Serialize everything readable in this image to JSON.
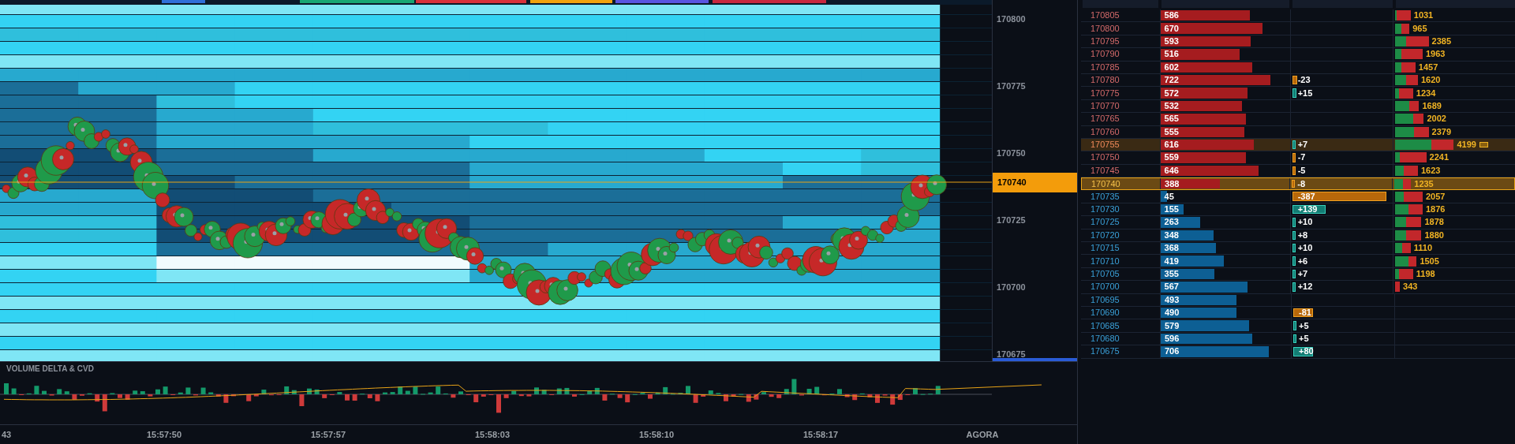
{
  "top_strip": [
    {
      "color": "#2f6fd8"
    },
    {
      "color": "#18a673"
    },
    {
      "color": "#d8313b"
    },
    {
      "color": "#f2a20c"
    },
    {
      "color": "#5a55e0"
    },
    {
      "color": "#c8283f"
    }
  ],
  "price_axis": {
    "labels": [
      "170800",
      "170775",
      "170750",
      "170725",
      "170700",
      "170675"
    ],
    "current": "170740"
  },
  "indicator": {
    "title": "VOLUME DELTA & CVD"
  },
  "time_axis": [
    "43",
    "15:57:50",
    "15:57:57",
    "15:58:03",
    "15:58:10",
    "15:58:17",
    "AGORA"
  ],
  "ladder": [
    {
      "price": "170805",
      "kind": "ask",
      "selected": false,
      "highlighted": false,
      "volume": {
        "text": "586",
        "level": 0.69
      },
      "traded": {
        "text": "1031",
        "level": 0.13,
        "buy": {
          "level": 0.01
        }
      }
    },
    {
      "price": "170800",
      "kind": "ask",
      "selected": false,
      "highlighted": false,
      "volume": {
        "text": "670",
        "level": 0.79
      },
      "traded": {
        "text": "965",
        "level": 0.12,
        "buy": {
          "level": 0.05
        }
      }
    },
    {
      "price": "170795",
      "kind": "ask",
      "selected": false,
      "highlighted": false,
      "volume": {
        "text": "593",
        "level": 0.7
      },
      "traded": {
        "text": "2385",
        "level": 0.28,
        "buy": {
          "level": 0.09
        }
      }
    },
    {
      "price": "170790",
      "kind": "ask",
      "selected": false,
      "highlighted": false,
      "volume": {
        "text": "516",
        "level": 0.61
      },
      "traded": {
        "text": "1963",
        "level": 0.23,
        "buy": {
          "level": 0.05
        }
      }
    },
    {
      "price": "170785",
      "kind": "ask",
      "selected": false,
      "highlighted": false,
      "volume": {
        "text": "602",
        "level": 0.71
      },
      "traded": {
        "text": "1457",
        "level": 0.17,
        "buy": {
          "level": 0.05
        }
      }
    },
    {
      "price": "170780",
      "kind": "ask",
      "selected": false,
      "highlighted": false,
      "volume": {
        "text": "722",
        "level": 0.85
      },
      "delta": {
        "text": "-23",
        "kind": "negative",
        "level": 0.05
      },
      "traded": {
        "text": "1620",
        "level": 0.19,
        "buy": {
          "level": 0.09
        }
      }
    },
    {
      "price": "170775",
      "kind": "ask",
      "selected": false,
      "highlighted": false,
      "volume": {
        "text": "572",
        "level": 0.67
      },
      "delta": {
        "text": "+15",
        "kind": "positive",
        "level": 0.04
      },
      "traded": {
        "text": "1234",
        "level": 0.15,
        "buy": {
          "level": 0.03
        }
      }
    },
    {
      "price": "170770",
      "kind": "ask",
      "selected": false,
      "highlighted": false,
      "volume": {
        "text": "532",
        "level": 0.63
      },
      "traded": {
        "text": "1689",
        "level": 0.2,
        "buy": {
          "level": 0.12
        }
      }
    },
    {
      "price": "170765",
      "kind": "ask",
      "selected": false,
      "highlighted": false,
      "volume": {
        "text": "565",
        "level": 0.66
      },
      "traded": {
        "text": "2002",
        "level": 0.24,
        "buy": {
          "level": 0.15
        }
      }
    },
    {
      "price": "170760",
      "kind": "ask",
      "selected": false,
      "highlighted": false,
      "volume": {
        "text": "555",
        "level": 0.65
      },
      "traded": {
        "text": "2379",
        "level": 0.28,
        "buy": {
          "level": 0.16
        }
      }
    },
    {
      "price": "170755",
      "kind": "ask",
      "selected": false,
      "highlighted": true,
      "volume": {
        "text": "616",
        "level": 0.72
      },
      "delta": {
        "text": "+7",
        "kind": "positive",
        "level": 0.03
      },
      "traded": {
        "text": "4199",
        "level": 0.49,
        "buy": {
          "level": 0.3
        }
      }
    },
    {
      "price": "170750",
      "kind": "ask",
      "selected": false,
      "highlighted": false,
      "volume": {
        "text": "559",
        "level": 0.66
      },
      "delta": {
        "text": "-7",
        "kind": "negative",
        "level": 0.03
      },
      "traded": {
        "text": "2241",
        "level": 0.26,
        "buy": {
          "level": 0.04
        }
      }
    },
    {
      "price": "170745",
      "kind": "ask",
      "selected": false,
      "highlighted": false,
      "volume": {
        "text": "646",
        "level": 0.76
      },
      "delta": {
        "text": "-5",
        "kind": "negative",
        "level": 0.03
      },
      "traded": {
        "text": "1623",
        "level": 0.19,
        "buy": {
          "level": 0.07
        }
      }
    },
    {
      "price": "170740",
      "kind": "ask",
      "selected": true,
      "highlighted": false,
      "volume": {
        "text": "388",
        "level": 0.46
      },
      "delta": {
        "text": "-8",
        "kind": "negative",
        "level": 0.03
      },
      "traded": {
        "text": "1235",
        "level": 0.14,
        "buy": {
          "level": 0.07
        }
      }
    },
    {
      "price": "170735",
      "kind": "bid",
      "selected": false,
      "highlighted": false,
      "volume": {
        "text": "45",
        "level": 0.05
      },
      "delta": {
        "text": "-387",
        "kind": "negative",
        "level": 0.92
      },
      "traded": {
        "text": "2057",
        "level": 0.23,
        "buy": {
          "level": 0.07
        }
      }
    },
    {
      "price": "170730",
      "kind": "bid",
      "selected": false,
      "highlighted": false,
      "volume": {
        "text": "155",
        "level": 0.18
      },
      "delta": {
        "text": "+139",
        "kind": "positive",
        "level": 0.33
      },
      "traded": {
        "text": "1876",
        "level": 0.23,
        "buy": {
          "level": 0.11
        }
      }
    },
    {
      "price": "170725",
      "kind": "bid",
      "selected": false,
      "highlighted": false,
      "volume": {
        "text": "263",
        "level": 0.31
      },
      "delta": {
        "text": "+10",
        "kind": "positive",
        "level": 0.03
      },
      "traded": {
        "text": "1878",
        "level": 0.22,
        "buy": {
          "level": 0.09
        }
      }
    },
    {
      "price": "170720",
      "kind": "bid",
      "selected": false,
      "highlighted": false,
      "volume": {
        "text": "348",
        "level": 0.41
      },
      "delta": {
        "text": "+8",
        "kind": "positive",
        "level": 0.03
      },
      "traded": {
        "text": "1880",
        "level": 0.22,
        "buy": {
          "level": 0.09
        }
      }
    },
    {
      "price": "170715",
      "kind": "bid",
      "selected": false,
      "highlighted": false,
      "volume": {
        "text": "368",
        "level": 0.43
      },
      "delta": {
        "text": "+10",
        "kind": "positive",
        "level": 0.03
      },
      "traded": {
        "text": "1110",
        "level": 0.13,
        "buy": {
          "level": 0.06
        }
      }
    },
    {
      "price": "170710",
      "kind": "bid",
      "selected": false,
      "highlighted": false,
      "volume": {
        "text": "419",
        "level": 0.49
      },
      "delta": {
        "text": "+6",
        "kind": "positive",
        "level": 0.03
      },
      "traded": {
        "text": "1505",
        "level": 0.18,
        "buy": {
          "level": 0.11
        }
      }
    },
    {
      "price": "170705",
      "kind": "bid",
      "selected": false,
      "highlighted": false,
      "volume": {
        "text": "355",
        "level": 0.42
      },
      "delta": {
        "text": "+7",
        "kind": "positive",
        "level": 0.03
      },
      "traded": {
        "text": "1198",
        "level": 0.15,
        "buy": {
          "level": 0.03
        }
      }
    },
    {
      "price": "170700",
      "kind": "bid",
      "selected": false,
      "highlighted": false,
      "volume": {
        "text": "567",
        "level": 0.67
      },
      "delta": {
        "text": "+12",
        "kind": "positive",
        "level": 0.03
      },
      "traded": {
        "text": "343",
        "level": 0.04
      }
    },
    {
      "price": "170695",
      "kind": "bid",
      "selected": false,
      "highlighted": false,
      "volume": {
        "text": "493",
        "level": 0.58
      }
    },
    {
      "price": "170690",
      "kind": "bid",
      "selected": false,
      "highlighted": false,
      "volume": {
        "text": "490",
        "level": 0.58
      },
      "delta": {
        "text": "-81",
        "kind": "negative",
        "level": 0.19
      }
    },
    {
      "price": "170685",
      "kind": "bid",
      "selected": false,
      "highlighted": false,
      "volume": {
        "text": "579",
        "level": 0.68
      },
      "delta": {
        "text": "+5",
        "kind": "positive",
        "level": 0.03
      }
    },
    {
      "price": "170680",
      "kind": "bid",
      "selected": false,
      "highlighted": false,
      "volume": {
        "text": "596",
        "level": 0.7
      },
      "delta": {
        "text": "+5",
        "kind": "positive",
        "level": 0.03
      }
    },
    {
      "price": "170675",
      "kind": "bid",
      "selected": false,
      "highlighted": false,
      "volume": {
        "text": "706",
        "level": 0.83
      },
      "delta": {
        "text": "+80",
        "kind": "positive",
        "level": 0.19
      }
    }
  ]
}
